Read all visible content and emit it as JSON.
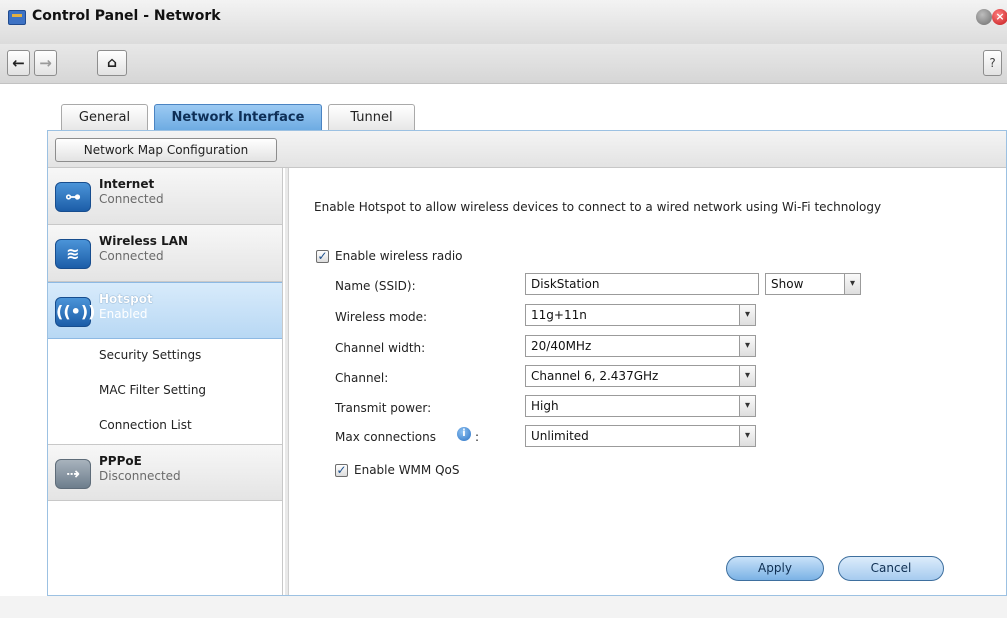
{
  "window": {
    "title": "Control Panel - Network",
    "min_glyph": "",
    "close_glyph": "×",
    "help_label": "?"
  },
  "toolbar": {
    "back_glyph": "←",
    "forward_glyph": "→",
    "home_glyph": "⌂"
  },
  "tabs": [
    {
      "label": "General"
    },
    {
      "label": "Network Interface"
    },
    {
      "label": "Tunnel"
    }
  ],
  "panel": {
    "map_button_label": "Network Map Configuration"
  },
  "sidebar": {
    "items": [
      {
        "name": "Internet",
        "status": "Connected",
        "icon": "ethernet-icon"
      },
      {
        "name": "Wireless LAN",
        "status": "Connected",
        "icon": "wifi-icon"
      },
      {
        "name": "Hotspot",
        "status": "Enabled",
        "icon": "hotspot-icon"
      },
      {
        "name": "PPPoE",
        "status": "Disconnected",
        "icon": "pppoe-icon"
      }
    ],
    "subitems": [
      "Security Settings",
      "MAC Filter Setting",
      "Connection List"
    ]
  },
  "content": {
    "description": "Enable Hotspot to allow wireless devices to connect to a wired network using Wi-Fi technology",
    "enable_radio_label": "Enable wireless radio",
    "enable_radio_checked": true,
    "fields": {
      "ssid_label": "Name (SSID):",
      "ssid_value": "DiskStation",
      "ssid_visibility": "Show",
      "mode_label": "Wireless mode:",
      "mode_value": "11g+11n",
      "width_label": "Channel width:",
      "width_value": "20/40MHz",
      "channel_label": "Channel:",
      "channel_value": "Channel 6, 2.437GHz",
      "power_label": "Transmit power:",
      "power_value": "High",
      "maxconn_label": "Max connections",
      "maxconn_suffix": ":",
      "maxconn_value": "Unlimited"
    },
    "wmm_label": "Enable WMM QoS",
    "wmm_checked": true,
    "apply_label": "Apply",
    "cancel_label": "Cancel"
  }
}
